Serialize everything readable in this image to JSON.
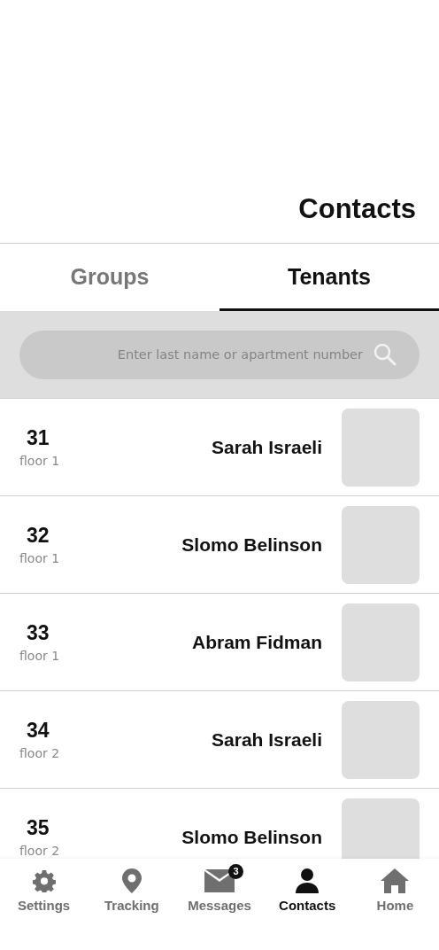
{
  "header": {
    "title": "Contacts"
  },
  "tabs": [
    {
      "label": "Groups",
      "selected": false
    },
    {
      "label": "Tenants",
      "selected": true
    }
  ],
  "search": {
    "placeholder": "Enter last name or apartment number"
  },
  "contacts": [
    {
      "apartment": "31",
      "floor": "floor 1",
      "name": "Sarah Israeli"
    },
    {
      "apartment": "32",
      "floor": "floor 1",
      "name": "Slomo Belinson"
    },
    {
      "apartment": "33",
      "floor": "floor 1",
      "name": "Abram Fidman"
    },
    {
      "apartment": "34",
      "floor": "floor 2",
      "name": "Sarah Israeli"
    },
    {
      "apartment": "35",
      "floor": "floor 2",
      "name": "Slomo Belinson"
    }
  ],
  "nav": [
    {
      "kind": "settings",
      "label": "Settings",
      "selected": false
    },
    {
      "kind": "tracking",
      "label": "Tracking",
      "selected": false
    },
    {
      "kind": "messages",
      "label": "Messages",
      "selected": false,
      "badge": "3"
    },
    {
      "kind": "contacts",
      "label": "Contacts",
      "selected": true
    },
    {
      "kind": "home",
      "label": "Home",
      "selected": false
    }
  ]
}
